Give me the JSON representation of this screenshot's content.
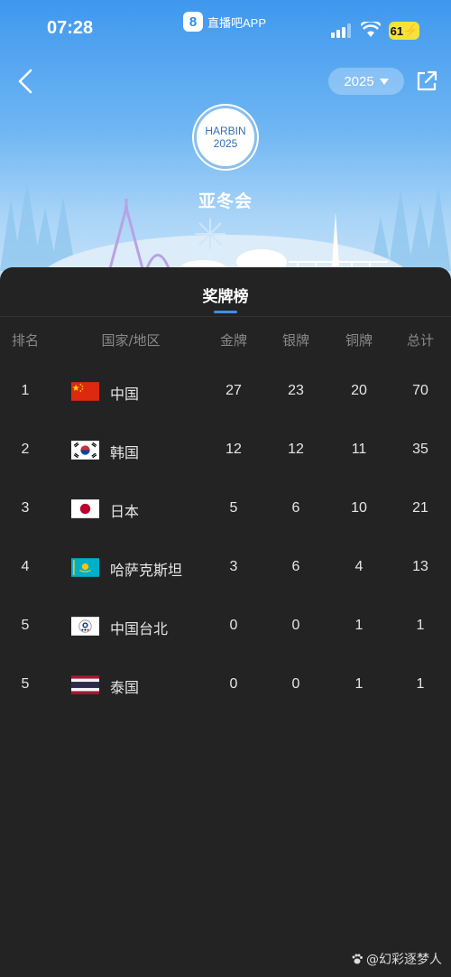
{
  "status_bar": {
    "time": "07:28",
    "app_name": "直播吧APP",
    "app_logo": "8",
    "battery": "61"
  },
  "header": {
    "year": "2025",
    "badge_top": "HARBIN",
    "badge_bottom": "2025",
    "event_title": "亚冬会"
  },
  "panel": {
    "title": "奖牌榜"
  },
  "table": {
    "columns": {
      "rank": "排名",
      "country": "国家/地区",
      "gold": "金牌",
      "silver": "银牌",
      "bronze": "铜牌",
      "total": "总计"
    },
    "rows": [
      {
        "rank": "1",
        "country": "中国",
        "flag": "china-flag",
        "gold": "27",
        "silver": "23",
        "bronze": "20",
        "total": "70"
      },
      {
        "rank": "2",
        "country": "韩国",
        "flag": "south-korea-flag",
        "gold": "12",
        "silver": "12",
        "bronze": "11",
        "total": "35"
      },
      {
        "rank": "3",
        "country": "日本",
        "flag": "japan-flag",
        "gold": "5",
        "silver": "6",
        "bronze": "10",
        "total": "21"
      },
      {
        "rank": "4",
        "country": "哈萨克斯坦",
        "flag": "kazakhstan-flag",
        "gold": "3",
        "silver": "6",
        "bronze": "4",
        "total": "13"
      },
      {
        "rank": "5",
        "country": "中国台北",
        "flag": "chinese-taipei-flag",
        "gold": "0",
        "silver": "0",
        "bronze": "1",
        "total": "1"
      },
      {
        "rank": "5",
        "country": "泰国",
        "flag": "thailand-flag",
        "gold": "0",
        "silver": "0",
        "bronze": "1",
        "total": "1"
      }
    ]
  },
  "watermark": "@幻彩逐梦人",
  "colors": {
    "accent": "#3e8fe6",
    "panel_bg": "#232323",
    "hero_top": "#3f98ee"
  }
}
